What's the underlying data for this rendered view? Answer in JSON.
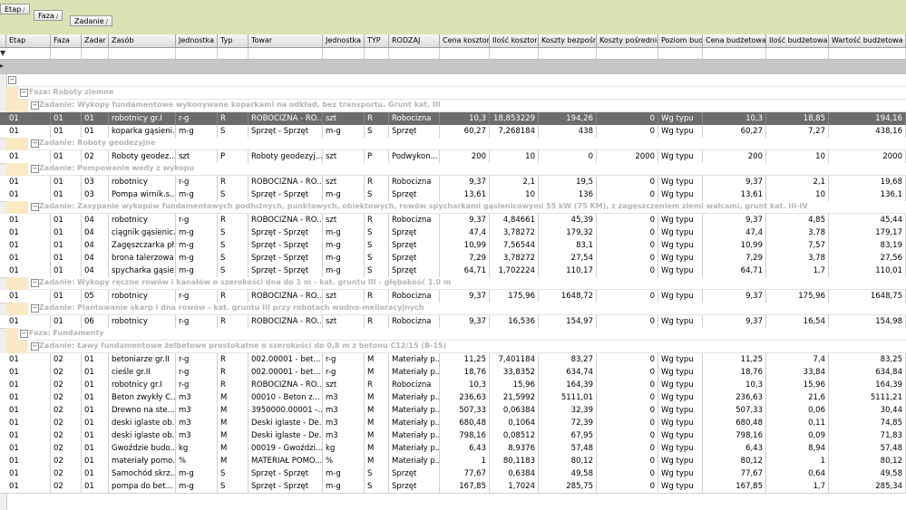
{
  "group_panel": {
    "chips": [
      {
        "label": "Etap",
        "sort": "/"
      },
      {
        "label": "Faza",
        "sort": "/"
      },
      {
        "label": "Zadanie",
        "sort": "/"
      }
    ]
  },
  "filter_indicator": "▼",
  "columns": [
    "Etap",
    "Faza",
    "Zadar",
    "Zasób",
    "Jednostka",
    "Typ",
    "Towar",
    "Jednostka",
    "TYP",
    "RODZAJ",
    "Cena kosztor",
    "Ilość kosztor",
    "Koszty bezpośr.",
    "Koszty pośrednie",
    "Poziom bud",
    "Cena budżetowa",
    "Ilość budżetowa",
    "Wartość budżetowa"
  ],
  "rows": [
    {
      "kind": "faza",
      "label": "Faza: Roboty ziemne"
    },
    {
      "kind": "zadanie",
      "label": "Zadanie: Wykopy fundamentowe wykonywane koparkami na odkład, bez transportu. Grunt kat. III"
    },
    {
      "kind": "data",
      "selected": true,
      "cells": [
        "01",
        "01",
        "01",
        "robotnicy gr.I",
        "r-g",
        "R",
        "ROBOCIZNA - RO...",
        "szt",
        "R",
        "Robocizna",
        "10,3",
        "18,853229",
        "194,26",
        "0",
        "Wg typu",
        "10,3",
        "18,85",
        "194,16"
      ]
    },
    {
      "kind": "data",
      "cells": [
        "01",
        "01",
        "01",
        "koparka gąsieni...",
        "m-g",
        "S",
        "Sprzęt - Sprzęt",
        "m-g",
        "S",
        "Sprzęt",
        "60,27",
        "7,268184",
        "438",
        "0",
        "Wg typu",
        "60,27",
        "7,27",
        "438,16"
      ]
    },
    {
      "kind": "zadanie",
      "label": "Zadanie: Roboty geodezyjne"
    },
    {
      "kind": "data",
      "cells": [
        "01",
        "01",
        "02",
        "Roboty geodez...",
        "szt",
        "P",
        "Roboty geodezyj...",
        "szt",
        "P",
        "Podwykon...",
        "200",
        "10",
        "0",
        "2000",
        "Wg typu",
        "200",
        "10",
        "2000"
      ]
    },
    {
      "kind": "zadanie",
      "label": "Zadanie: Pompowanie wody z wykopu"
    },
    {
      "kind": "data",
      "cells": [
        "01",
        "01",
        "03",
        "robotnicy",
        "r-g",
        "R",
        "ROBOCIZNA - RO...",
        "szt",
        "R",
        "Robocizna",
        "9,37",
        "2,1",
        "19,5",
        "0",
        "Wg typu",
        "9,37",
        "2,1",
        "19,68"
      ]
    },
    {
      "kind": "data",
      "cells": [
        "01",
        "01",
        "03",
        "Pompa wirnik.s...",
        "m-g",
        "S",
        "Sprzęt - Sprzęt",
        "m-g",
        "S",
        "Sprzęt",
        "13,61",
        "10",
        "136",
        "0",
        "Wg typu",
        "13,61",
        "10",
        "136,1"
      ]
    },
    {
      "kind": "zadanie",
      "label": "Zadanie: Zasypanie wykopów fundamentowych podłużnych, punktowych, obiektowych, rowów spycharkami gąsienicowymi 55 kW (75 KM), z zagęszczeniem ziemi walcami, grunt kat. III-IV"
    },
    {
      "kind": "data",
      "cells": [
        "01",
        "01",
        "04",
        "robotnicy",
        "r-g",
        "R",
        "ROBOCIZNA - RO...",
        "szt",
        "R",
        "Robocizna",
        "9,37",
        "4,84661",
        "45,39",
        "0",
        "Wg typu",
        "9,37",
        "4,85",
        "45,44"
      ]
    },
    {
      "kind": "data",
      "cells": [
        "01",
        "01",
        "04",
        "ciągnik gąsienic...",
        "m-g",
        "S",
        "Sprzęt - Sprzęt",
        "m-g",
        "S",
        "Sprzęt",
        "47,4",
        "3,78272",
        "179,32",
        "0",
        "Wg typu",
        "47,4",
        "3,78",
        "179,17"
      ]
    },
    {
      "kind": "data",
      "cells": [
        "01",
        "01",
        "04",
        "Zagęszczarka pł...",
        "m-g",
        "S",
        "Sprzęt - Sprzęt",
        "m-g",
        "S",
        "Sprzęt",
        "10,99",
        "7,56544",
        "83,1",
        "0",
        "Wg typu",
        "10,99",
        "7,57",
        "83,19"
      ]
    },
    {
      "kind": "data",
      "cells": [
        "01",
        "01",
        "04",
        "brona talerzowa",
        "m-g",
        "S",
        "Sprzęt - Sprzęt",
        "m-g",
        "S",
        "Sprzęt",
        "7,29",
        "3,78272",
        "27,54",
        "0",
        "Wg typu",
        "7,29",
        "3,78",
        "27,56"
      ]
    },
    {
      "kind": "data",
      "cells": [
        "01",
        "01",
        "04",
        "spycharka gąsie...",
        "m-g",
        "S",
        "Sprzęt - Sprzęt",
        "m-g",
        "S",
        "Sprzęt",
        "64,71",
        "1,702224",
        "110,17",
        "0",
        "Wg typu",
        "64,71",
        "1,7",
        "110,01"
      ]
    },
    {
      "kind": "zadanie",
      "label": "Zadanie: Wykopy ręczne rowów i kanałów o szerokości dna do 1 m - kat. gruntu III - głębokość 1.0 m"
    },
    {
      "kind": "data",
      "cells": [
        "01",
        "01",
        "05",
        "robotnicy",
        "r-g",
        "R",
        "ROBOCIZNA - RO...",
        "szt",
        "R",
        "Robocizna",
        "9,37",
        "175,96",
        "1648,72",
        "0",
        "Wg typu",
        "9,37",
        "175,96",
        "1648,75"
      ]
    },
    {
      "kind": "zadanie",
      "label": "Zadanie: Plantowanie skarp i dna rowów - kat. gruntu III przy robotach wodno-melioracyjnych"
    },
    {
      "kind": "data",
      "cells": [
        "01",
        "01",
        "06",
        "robotnicy",
        "r-g",
        "R",
        "ROBOCIZNA - RO...",
        "szt",
        "R",
        "Robocizna",
        "9,37",
        "16,536",
        "154,97",
        "0",
        "Wg typu",
        "9,37",
        "16,54",
        "154,98"
      ]
    },
    {
      "kind": "faza",
      "label": "Faza: Fundamenty"
    },
    {
      "kind": "zadanie",
      "label": "Zadanie: Ławy fundamentowe żelbetowe prostokątne o szerokości do 0,8 m z betonu C12/15 (B-15)"
    },
    {
      "kind": "data",
      "cells": [
        "01",
        "02",
        "01",
        "betoniarze gr.II",
        "r-g",
        "R",
        "002.00001 - bet...",
        "r-g",
        "M",
        "Materiały p...",
        "11,25",
        "7,401184",
        "83,27",
        "0",
        "Wg typu",
        "11,25",
        "7,4",
        "83,25"
      ]
    },
    {
      "kind": "data",
      "cells": [
        "01",
        "02",
        "01",
        "cieśle gr.II",
        "r-g",
        "R",
        "002.00001 - bet...",
        "r-g",
        "M",
        "Materiały p...",
        "18,76",
        "33,8352",
        "634,74",
        "0",
        "Wg typu",
        "18,76",
        "33,84",
        "634,84"
      ]
    },
    {
      "kind": "data",
      "cells": [
        "01",
        "02",
        "01",
        "robotnicy gr.I",
        "r-g",
        "R",
        "ROBOCIZNA - RO...",
        "szt",
        "R",
        "Robocizna",
        "10,3",
        "15,96",
        "164,39",
        "0",
        "Wg typu",
        "10,3",
        "15,96",
        "164,39"
      ]
    },
    {
      "kind": "data",
      "cells": [
        "01",
        "02",
        "01",
        "Beton zwykły C...",
        "m3",
        "M",
        "00010 - Beton z...",
        "m3",
        "M",
        "Materiały p...",
        "236,63",
        "21,5992",
        "5111,01",
        "0",
        "Wg typu",
        "236,63",
        "21,6",
        "5111,21"
      ]
    },
    {
      "kind": "data",
      "cells": [
        "01",
        "02",
        "01",
        "Drewno na ste...",
        "m3",
        "M",
        "3950000.00001 -...",
        "m3",
        "M",
        "Materiały p...",
        "507,33",
        "0,06384",
        "32,39",
        "0",
        "Wg typu",
        "507,33",
        "0,06",
        "30,44"
      ]
    },
    {
      "kind": "data",
      "cells": [
        "01",
        "02",
        "01",
        "deski iglaste ob...",
        "m3",
        "M",
        "Deski iglaste - De...",
        "m3",
        "M",
        "Materiały p...",
        "680,48",
        "0,1064",
        "72,39",
        "0",
        "Wg typu",
        "680,48",
        "0,11",
        "74,85"
      ]
    },
    {
      "kind": "data",
      "cells": [
        "01",
        "02",
        "01",
        "deski iglaste ob...",
        "m3",
        "M",
        "Deski iglaste - De...",
        "m3",
        "M",
        "Materiały p...",
        "798,16",
        "0,08512",
        "67,95",
        "0",
        "Wg typu",
        "798,16",
        "0,09",
        "71,83"
      ]
    },
    {
      "kind": "data",
      "cells": [
        "01",
        "02",
        "01",
        "Gwoździe budo...",
        "kg",
        "M",
        "00019 - Gwoździ...",
        "kg",
        "M",
        "Materiały p...",
        "6,43",
        "8,9376",
        "57,48",
        "0",
        "Wg typu",
        "6,43",
        "8,94",
        "57,48"
      ]
    },
    {
      "kind": "data",
      "cells": [
        "01",
        "02",
        "01",
        "materiały pomo...",
        "%",
        "M",
        "MATERIAŁ POMO...",
        "%",
        "M",
        "Materiały p...",
        "1",
        "80,1183",
        "80,12",
        "0",
        "Wg typu",
        "80,12",
        "1",
        "80,12"
      ]
    },
    {
      "kind": "data",
      "cells": [
        "01",
        "02",
        "01",
        "Samochód skrz...",
        "m-g",
        "S",
        "Sprzęt - Sprzęt",
        "m-g",
        "S",
        "Sprzęt",
        "77,67",
        "0,6384",
        "49,58",
        "0",
        "Wg typu",
        "77,67",
        "0,64",
        "49,58"
      ]
    },
    {
      "kind": "data",
      "cells": [
        "01",
        "02",
        "01",
        "pompa do bet...",
        "m-g",
        "S",
        "Sprzęt - Sprzęt",
        "m-g",
        "S",
        "Sprzęt",
        "167,85",
        "1,7024",
        "285,75",
        "0",
        "Wg typu",
        "167,85",
        "1,7",
        "285,34"
      ]
    }
  ]
}
